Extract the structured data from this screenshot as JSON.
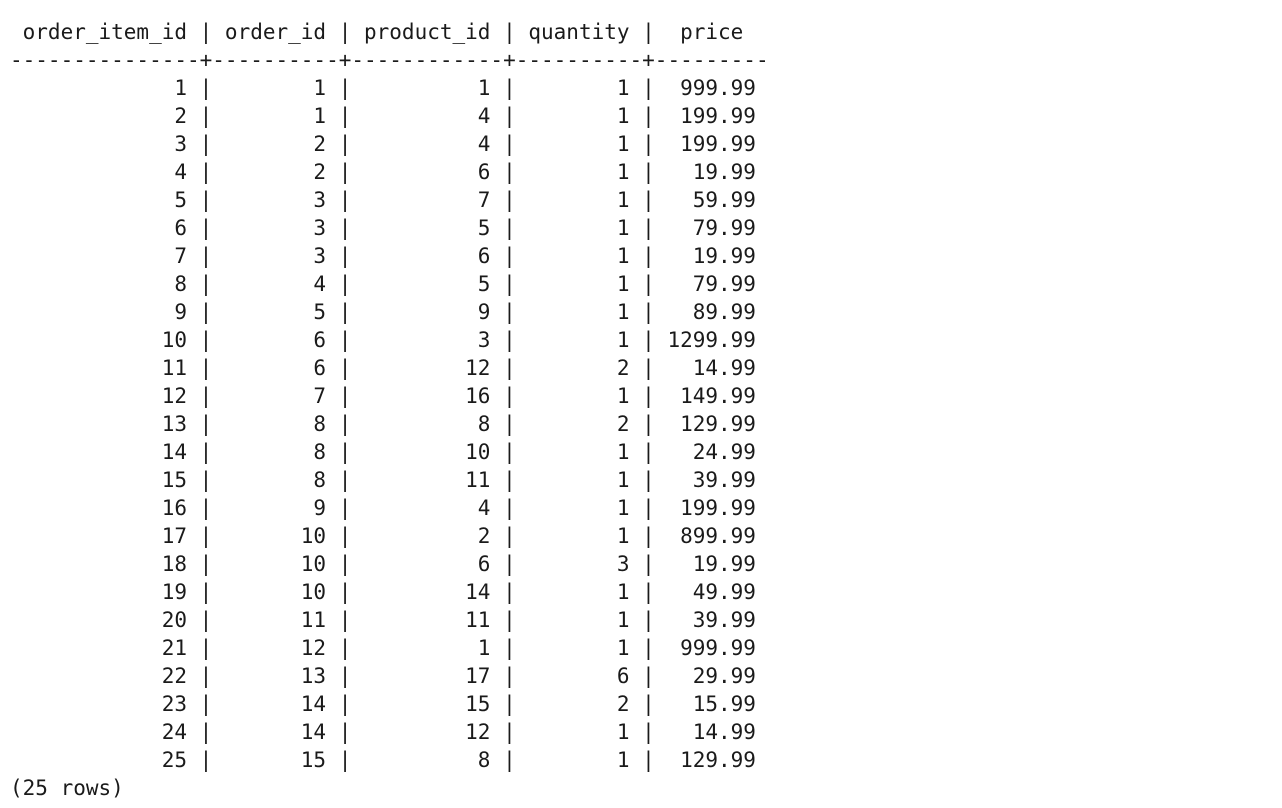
{
  "query_result": {
    "columns": [
      "order_item_id",
      "order_id",
      "product_id",
      "quantity",
      "price"
    ],
    "align": [
      "right",
      "right",
      "right",
      "right",
      "right"
    ],
    "rows": [
      [
        "1",
        "1",
        "1",
        "1",
        "999.99"
      ],
      [
        "2",
        "1",
        "4",
        "1",
        "199.99"
      ],
      [
        "3",
        "2",
        "4",
        "1",
        "199.99"
      ],
      [
        "4",
        "2",
        "6",
        "1",
        "19.99"
      ],
      [
        "5",
        "3",
        "7",
        "1",
        "59.99"
      ],
      [
        "6",
        "3",
        "5",
        "1",
        "79.99"
      ],
      [
        "7",
        "3",
        "6",
        "1",
        "19.99"
      ],
      [
        "8",
        "4",
        "5",
        "1",
        "79.99"
      ],
      [
        "9",
        "5",
        "9",
        "1",
        "89.99"
      ],
      [
        "10",
        "6",
        "3",
        "1",
        "1299.99"
      ],
      [
        "11",
        "6",
        "12",
        "2",
        "14.99"
      ],
      [
        "12",
        "7",
        "16",
        "1",
        "149.99"
      ],
      [
        "13",
        "8",
        "8",
        "2",
        "129.99"
      ],
      [
        "14",
        "8",
        "10",
        "1",
        "24.99"
      ],
      [
        "15",
        "8",
        "11",
        "1",
        "39.99"
      ],
      [
        "16",
        "9",
        "4",
        "1",
        "199.99"
      ],
      [
        "17",
        "10",
        "2",
        "1",
        "899.99"
      ],
      [
        "18",
        "10",
        "6",
        "3",
        "19.99"
      ],
      [
        "19",
        "10",
        "14",
        "1",
        "49.99"
      ],
      [
        "20",
        "11",
        "11",
        "1",
        "39.99"
      ],
      [
        "21",
        "12",
        "1",
        "1",
        "999.99"
      ],
      [
        "22",
        "13",
        "17",
        "6",
        "29.99"
      ],
      [
        "23",
        "14",
        "15",
        "2",
        "15.99"
      ],
      [
        "24",
        "14",
        "12",
        "1",
        "14.99"
      ],
      [
        "25",
        "15",
        "8",
        "1",
        "129.99"
      ]
    ],
    "footer": "(25 rows)"
  }
}
